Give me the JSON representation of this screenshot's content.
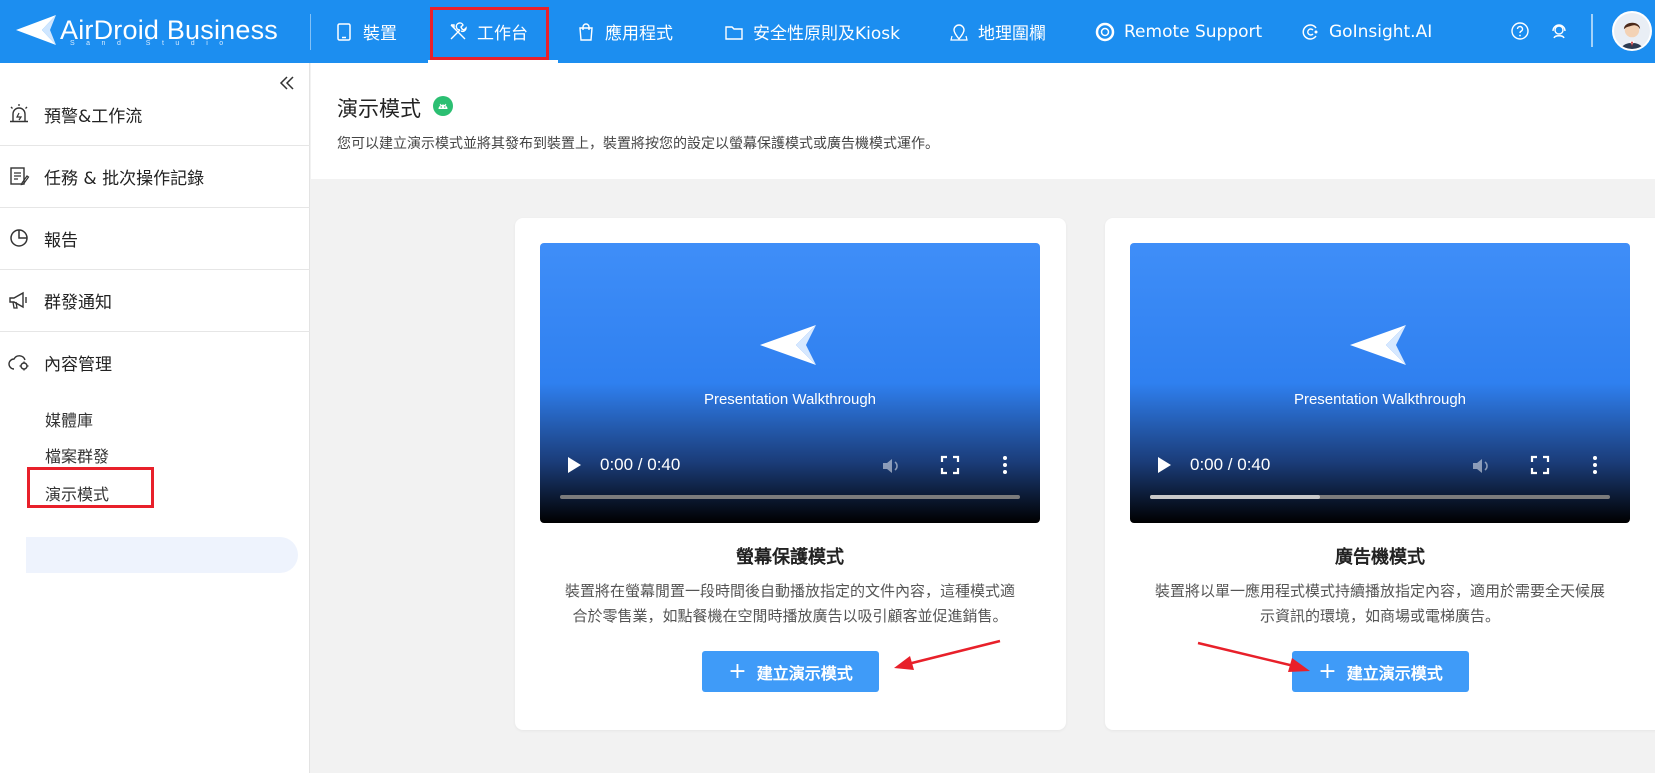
{
  "app": {
    "logo_text": "AirDroid Business",
    "logo_sub": "Sand Studio"
  },
  "topnav": [
    {
      "label": "裝置",
      "icon": "tablet-icon"
    },
    {
      "label": "工作台",
      "icon": "tools-icon",
      "active": true
    },
    {
      "label": "應用程式",
      "icon": "shopping-bag-icon"
    },
    {
      "label": "安全性原則及Kiosk",
      "icon": "folder-icon"
    },
    {
      "label": "地理圍欄",
      "icon": "map-pin-icon"
    },
    {
      "label": "Remote Support",
      "icon": "lifebuoy-icon"
    },
    {
      "label": "GoInsight.AI",
      "icon": "insight-icon"
    }
  ],
  "top_icons": [
    "help-icon",
    "support-icon",
    "user-avatar"
  ],
  "sidebar": {
    "items": [
      {
        "label": "預警&工作流",
        "icon": "alarm-icon"
      },
      {
        "label": "任務 & 批次操作記錄",
        "icon": "task-log-icon"
      },
      {
        "label": "報告",
        "icon": "pie-chart-icon"
      },
      {
        "label": "群發通知",
        "icon": "megaphone-icon"
      },
      {
        "label": "內容管理",
        "icon": "cloud-gear-icon"
      }
    ],
    "sub_items": [
      "媒體庫",
      "檔案群發",
      "演示模式"
    ],
    "active_sub": "演示模式"
  },
  "page": {
    "title": "演示模式",
    "description": "您可以建立演示模式並將其發布到裝置上，裝置將按您的設定以螢幕保護模式或廣告機模式運作。"
  },
  "cards": [
    {
      "video_title": "Presentation Walkthrough",
      "time": "0:00 / 0:40",
      "buffered": 0,
      "title": "螢幕保護模式",
      "desc_line1": "裝置將在螢幕閒置一段時間後自動播放指定的文件內容，這種模式適",
      "desc_line2": "合於零售業，如點餐機在空閒時播放廣告以吸引顧客並促進銷售。",
      "button": "建立演示模式"
    },
    {
      "video_title": "Presentation Walkthrough",
      "time": "0:00 / 0:40",
      "buffered": 0.37,
      "title": "廣告機模式",
      "desc_line1": "裝置將以單一應用程式模式持續播放指定內容，適用於需要全天候展",
      "desc_line2": "示資訊的環境，如商場或電梯廣告。",
      "button": "建立演示模式"
    }
  ],
  "colors": {
    "topbar": "#1c8ef0",
    "primary_button": "#3f9bf8",
    "highlight": "#e8202a",
    "android_badge": "#2bbf72"
  }
}
